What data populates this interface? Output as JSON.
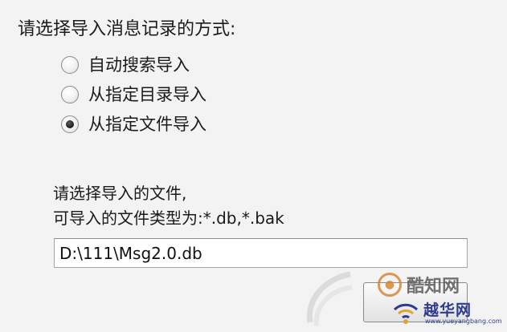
{
  "prompt": "请选择导入消息记录的方式:",
  "import_options": [
    {
      "label": "自动搜索导入",
      "checked": false
    },
    {
      "label": "从指定目录导入",
      "checked": false
    },
    {
      "label": "从指定文件导入",
      "checked": true
    }
  ],
  "file_hint": {
    "line1": "请选择导入的文件,",
    "line2": "可导入的文件类型为:*.db,*.bak"
  },
  "file_path": {
    "value": "D:\\111\\Msg2.0.db"
  },
  "watermarks": {
    "primary": "酷知网",
    "secondary": "越华网",
    "secondary_url": "www.yueyangbang.com"
  },
  "colors": {
    "background": "#f3f3f3",
    "watermark_orange": "#d9822b",
    "watermark_blue": "#2f3b8f"
  }
}
